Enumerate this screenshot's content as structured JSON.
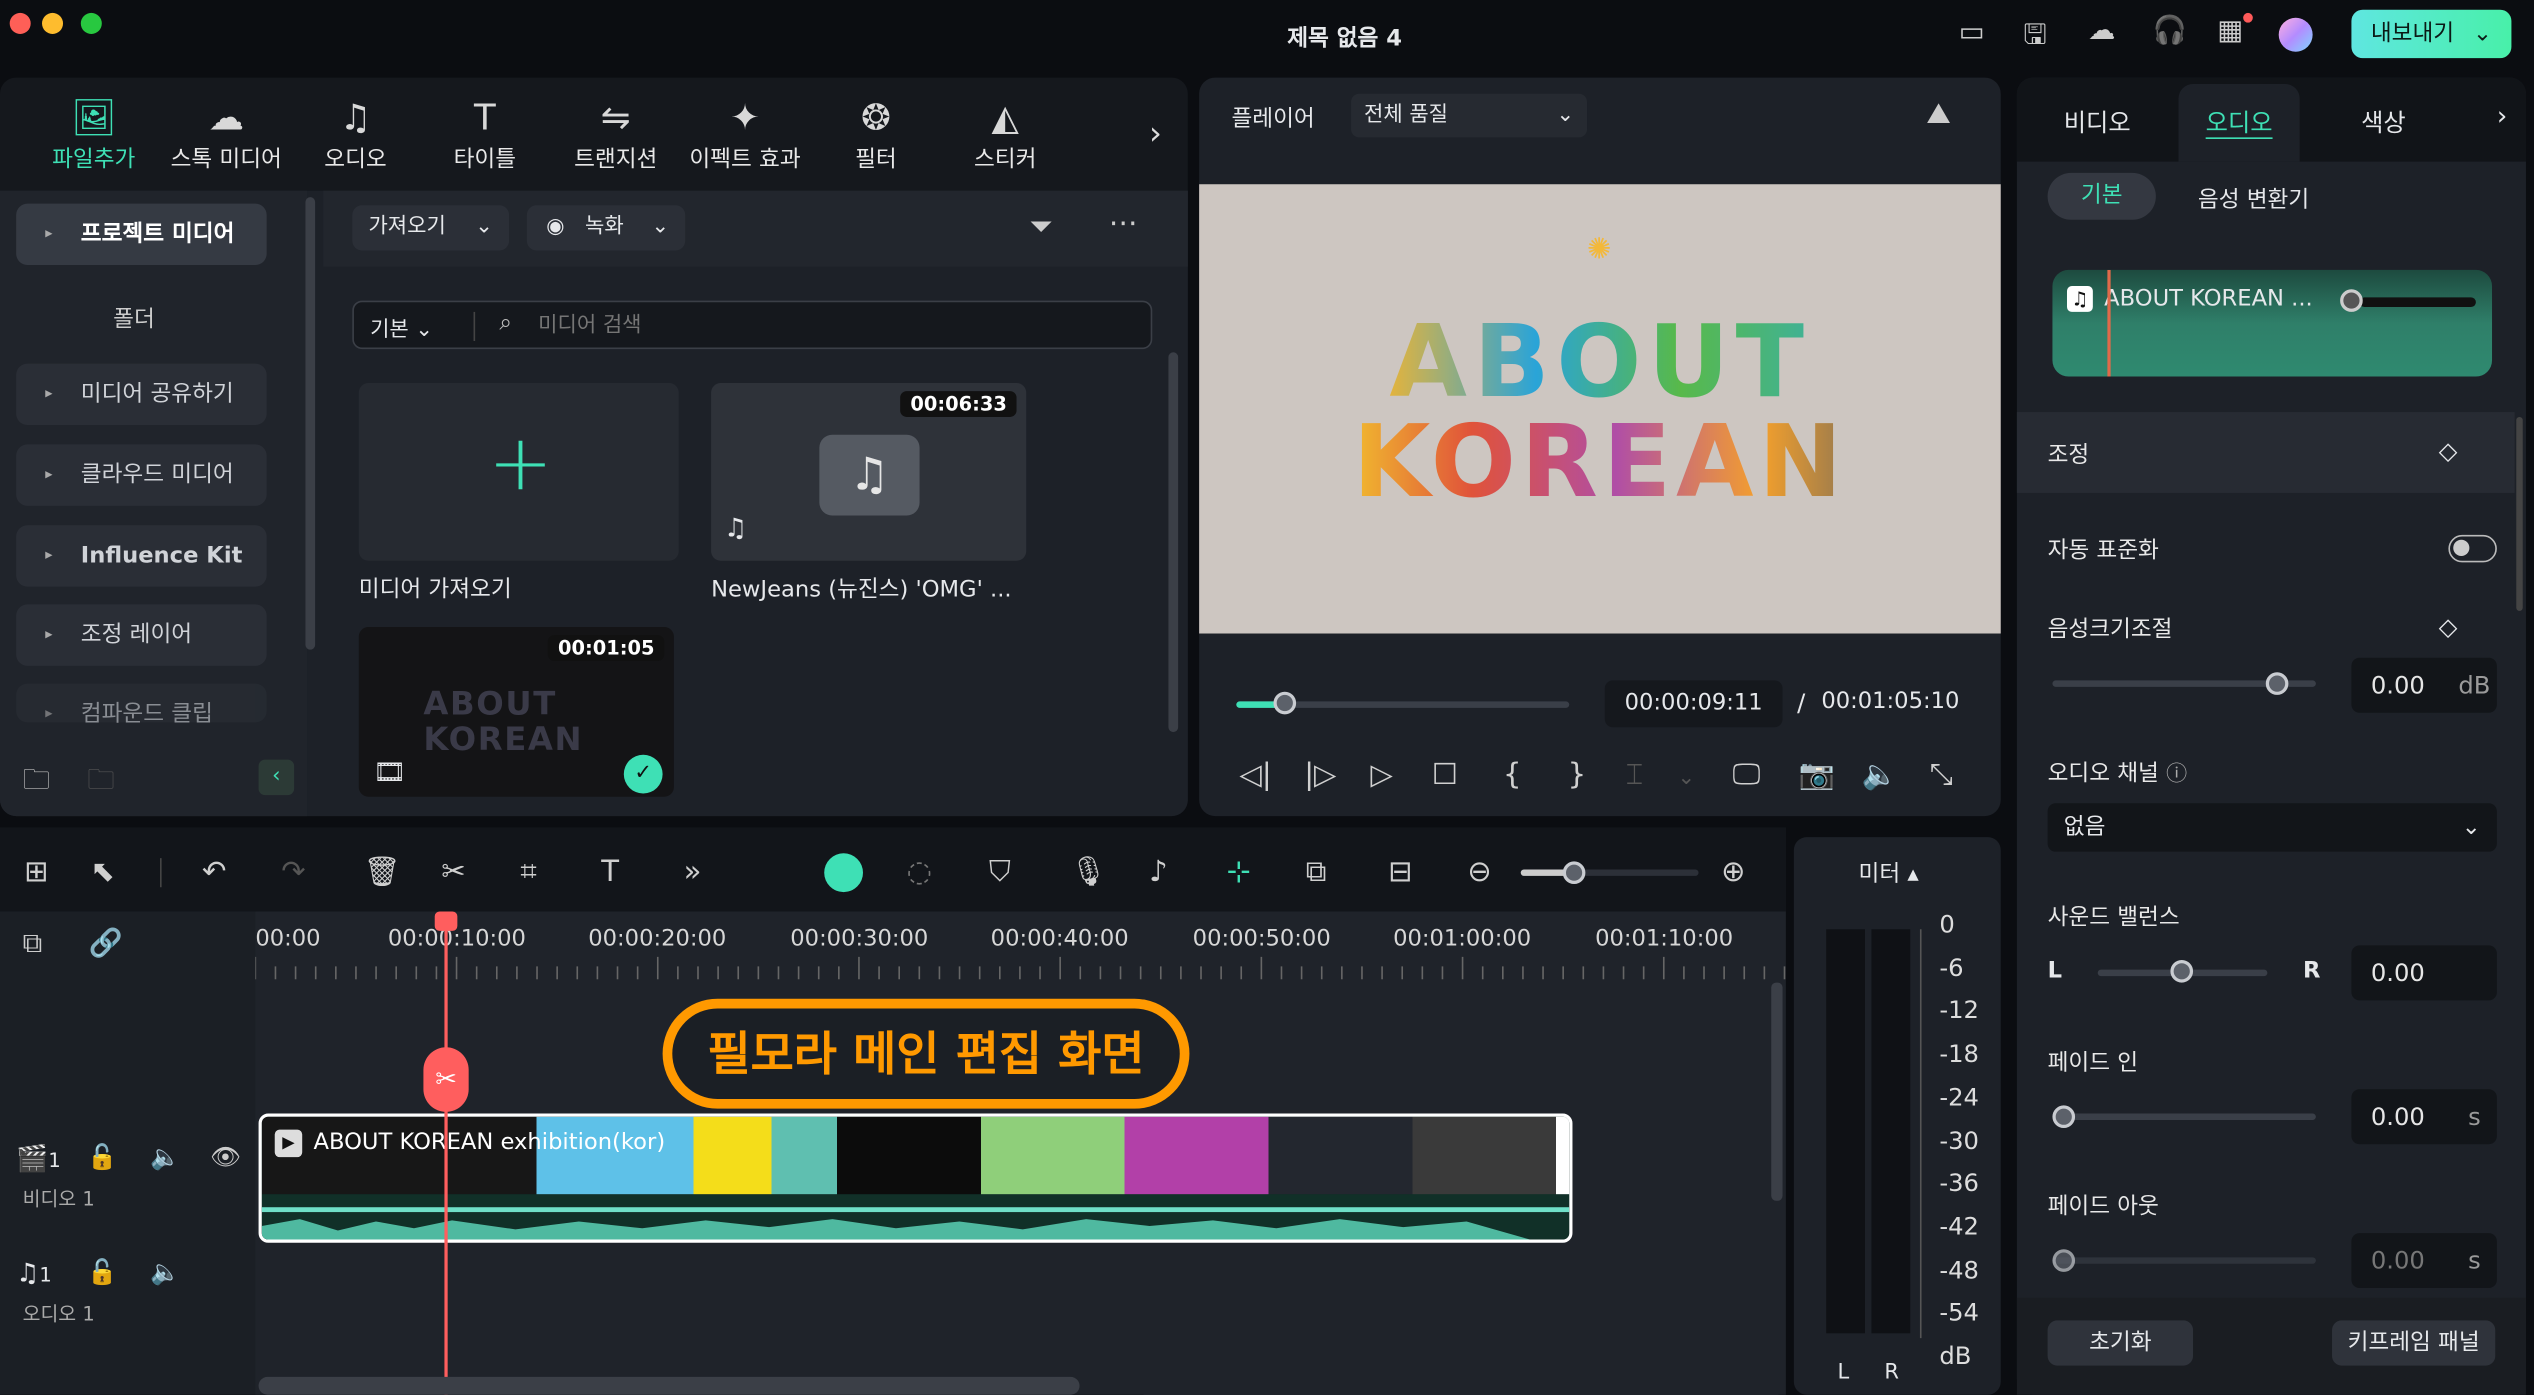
{
  "window": {
    "title": "제목 없음 4",
    "export_label": "내보내기"
  },
  "toolbar_tabs": [
    {
      "label": "파일추가",
      "icon": "media-icon"
    },
    {
      "label": "스톡 미디어",
      "icon": "stock-icon"
    },
    {
      "label": "오디오",
      "icon": "music-icon"
    },
    {
      "label": "타이틀",
      "icon": "title-icon"
    },
    {
      "label": "트랜지션",
      "icon": "transition-icon"
    },
    {
      "label": "이펙트 효과",
      "icon": "effects-icon"
    },
    {
      "label": "필터",
      "icon": "filter-icon"
    },
    {
      "label": "스티커",
      "icon": "sticker-icon"
    }
  ],
  "sidebar": {
    "items": [
      "프로젝트 미디어",
      "폴더",
      "미디어 공유하기",
      "클라우드 미디어",
      "Influence Kit",
      "조정 레이어",
      "컴파운드 클립"
    ]
  },
  "media": {
    "import_btn": "가져오기",
    "record_btn": "녹화",
    "view_select": "기본",
    "search_placeholder": "미디어 검색",
    "items": [
      {
        "label": "미디어 가져오기"
      },
      {
        "label": "NewJeans (뉴진스) 'OMG' ...",
        "duration": "00:06:33"
      },
      {
        "label": "",
        "duration": "00:01:05",
        "thumb_text": "ABOUT KOREAN"
      }
    ]
  },
  "player": {
    "label": "플레이어",
    "quality": "전체 품질",
    "video_text_line1": "ABOUT",
    "video_text_line2": "KOREAN",
    "current_time": "00:00:09:11",
    "total_time": "00:01:05:10",
    "progress": 0.145
  },
  "timeline": {
    "ruler": [
      "00:00",
      "00:00:10:00",
      "00:00:20:00",
      "00:00:30:00",
      "00:00:40:00",
      "00:00:50:00",
      "00:01:00:00",
      "00:01:10:00"
    ],
    "overlay_label": "필모라 메인 편집 화면",
    "clip_title": "ABOUT KOREAN exhibition(kor)",
    "video_track": {
      "num": "1",
      "name": "비디오 1"
    },
    "audio_track": {
      "num": "1",
      "name": "오디오 1"
    },
    "zoom_level": 0.3
  },
  "meter": {
    "label": "미터",
    "ticks": [
      "0",
      "-6",
      "-12",
      "-18",
      "-24",
      "-30",
      "-36",
      "-42",
      "-48",
      "-54",
      "dB"
    ],
    "l": "L",
    "r": "R"
  },
  "right_panel": {
    "tabs": [
      "비디오",
      "오디오",
      "색상"
    ],
    "active_tab": "오디오",
    "subtabs": [
      "기본",
      "음성 변환기"
    ],
    "clip_name": "ABOUT KOREAN ...",
    "adjust": "조정",
    "auto_normalize": "자동 표준화",
    "auto_normalize_on": false,
    "volume": "음성크기조절",
    "volume_value": "0.00",
    "volume_unit": "dB",
    "volume_level": 0.85,
    "channel": "오디오 채널",
    "channel_value": "없음",
    "balance": "사운드 밸런스",
    "balance_l": "L",
    "balance_r": "R",
    "balance_value": "0.00",
    "fade_in": "페이드 인",
    "fade_in_value": "0.00",
    "fade_out": "페이드 아웃",
    "fade_out_value": "0.00",
    "sec_unit": "s",
    "reset": "초기화",
    "keyframe": "키프레임 패널"
  },
  "colors": {
    "accent": "#3ee0b5",
    "playhead": "#ff5e5e",
    "overlay": "#ff9900"
  }
}
